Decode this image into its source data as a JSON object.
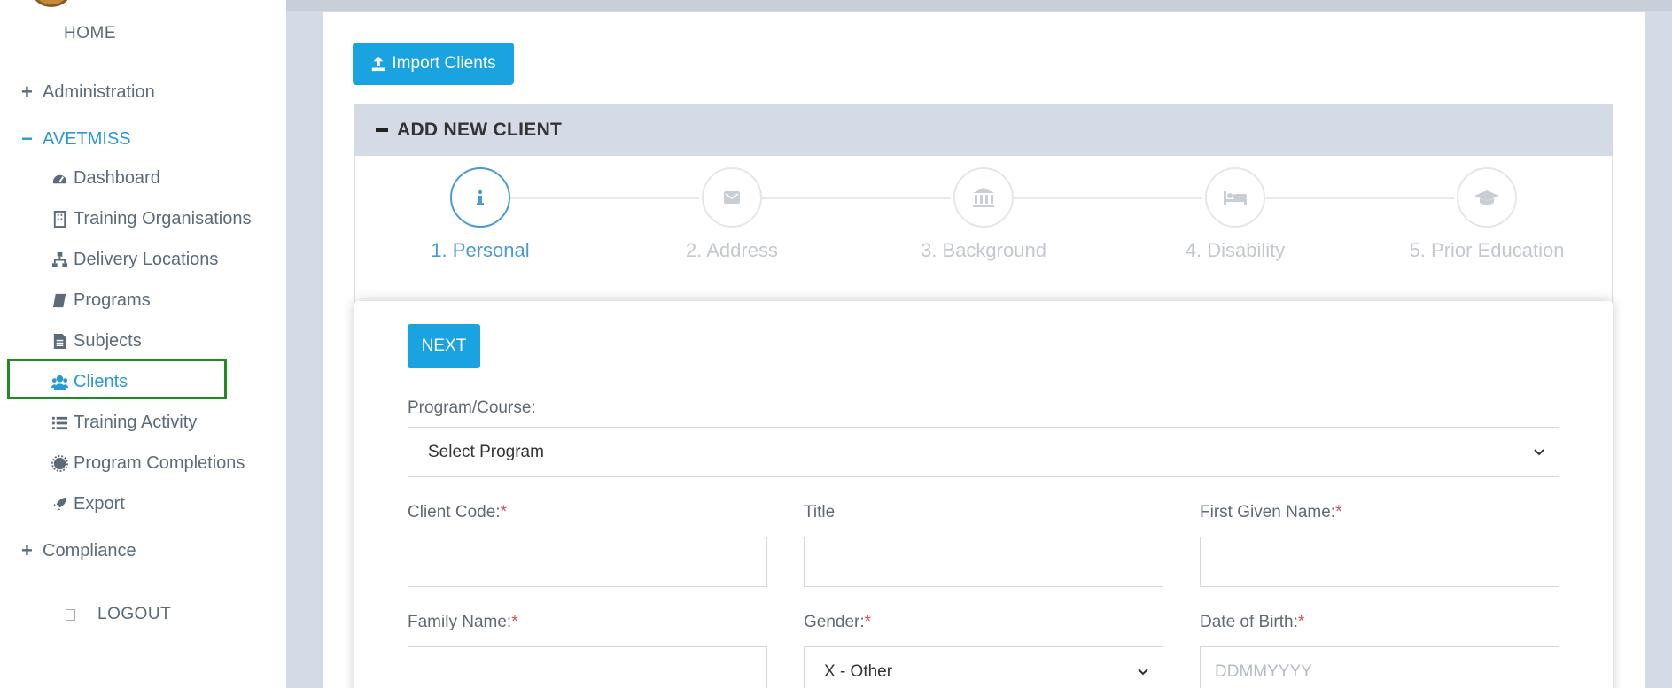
{
  "sidebar": {
    "home": "HOME",
    "administration": "Administration",
    "avetmiss": "AVETMISS",
    "items": [
      {
        "label": "Dashboard",
        "icon": "dashboard-icon"
      },
      {
        "label": "Training Organisations",
        "icon": "building-icon"
      },
      {
        "label": "Delivery Locations",
        "icon": "sitemap-icon"
      },
      {
        "label": "Programs",
        "icon": "book-icon"
      },
      {
        "label": "Subjects",
        "icon": "file-text-icon"
      },
      {
        "label": "Clients",
        "icon": "users-icon"
      },
      {
        "label": "Training Activity",
        "icon": "list-icon"
      },
      {
        "label": "Program Completions",
        "icon": "badge-icon"
      },
      {
        "label": "Export",
        "icon": "rocket-icon"
      }
    ],
    "compliance": "Compliance",
    "logout": "LOGOUT"
  },
  "main": {
    "import_button": "Import Clients",
    "panel_title": "ADD NEW CLIENT",
    "steps": [
      {
        "label": "1. Personal",
        "icon": "info-icon"
      },
      {
        "label": "2. Address",
        "icon": "envelope-icon"
      },
      {
        "label": "3. Background",
        "icon": "bank-icon"
      },
      {
        "label": "4. Disability",
        "icon": "bed-icon"
      },
      {
        "label": "5. Prior Education",
        "icon": "graduation-cap-icon"
      }
    ],
    "next_button": "NEXT",
    "form": {
      "program_label": "Program/Course:",
      "program_value": "Select Program",
      "client_code_label": "Client Code:",
      "title_label": "Title",
      "first_name_label": "First Given Name:",
      "family_name_label": "Family Name:",
      "gender_label": "Gender:",
      "gender_value": "X - Other",
      "dob_label": "Date of Birth:",
      "dob_placeholder": "DDMMYYYY",
      "required_mark": "*"
    }
  },
  "colors": {
    "accent": "#1aa3e1",
    "active_link": "#2a98d6",
    "highlight_box": "#1e8c1e",
    "required": "#d9534f"
  }
}
